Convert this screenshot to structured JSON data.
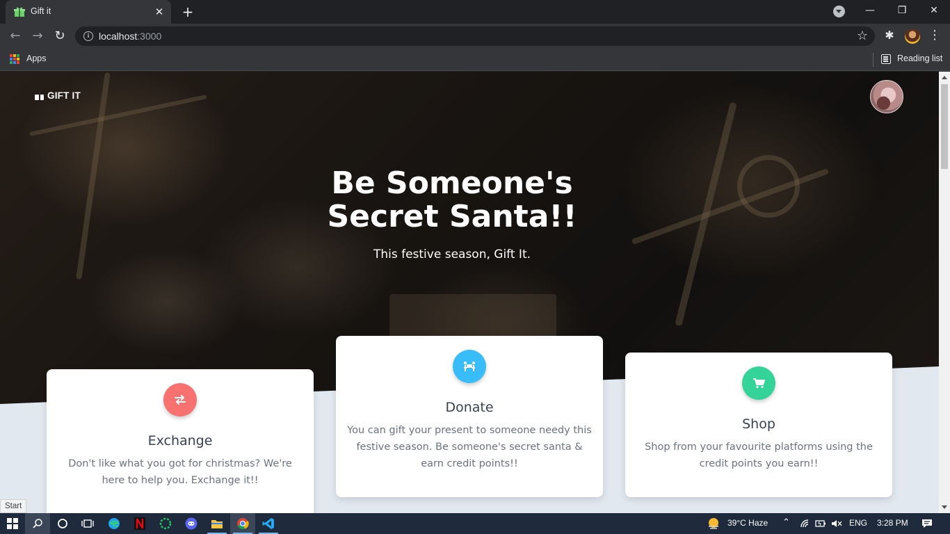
{
  "browser": {
    "tab_title": "Gift it",
    "tab_close": "✕",
    "new_tab": "+",
    "url_host": "localhost",
    "url_port": ":3000",
    "bookmarks": {
      "apps_label": "Apps",
      "reading_list_label": "Reading list"
    },
    "window_controls": {
      "minimize": "—",
      "restore": "❐",
      "close": "✕"
    }
  },
  "site": {
    "brand": "GIFT IT",
    "hero": {
      "title": "Be Someone's Secret Santa!!",
      "subtitle": "This festive season, Gift It."
    },
    "cards": [
      {
        "title": "Exchange",
        "text": "Don't like what you got for christmas? We're here to help you. Exchange it!!",
        "icon": "exchange-arrows-icon",
        "color": "#f87171"
      },
      {
        "title": "Donate",
        "text": "You can gift your present to someone needy this festive season. Be someone's secret santa & earn credit points!!",
        "icon": "people-carry-icon",
        "color": "#38bdf8"
      },
      {
        "title": "Shop",
        "text": "Shop from your favourite platforms using the credit points you earn!!",
        "icon": "shopping-cart-icon",
        "color": "#34d399"
      }
    ]
  },
  "status_tooltip": "Start",
  "taskbar": {
    "weather": "39°C  Haze",
    "language": "ENG",
    "time": "3:28 PM"
  }
}
